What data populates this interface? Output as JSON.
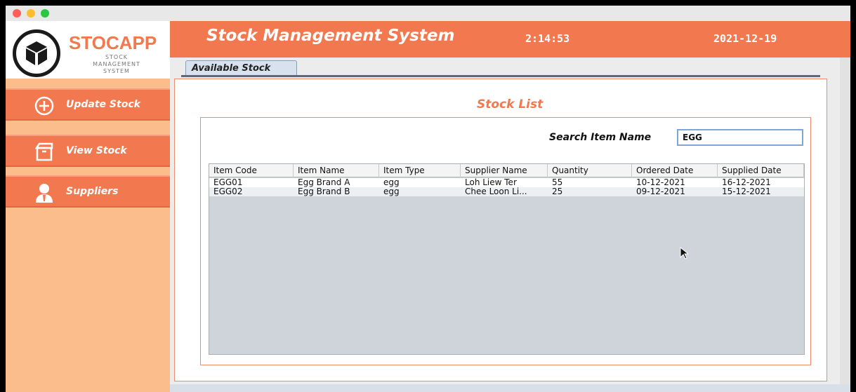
{
  "sidebar": {
    "logo_title": "STOCAPP",
    "logo_sub_1": "STOCK",
    "logo_sub_2": "MANAGEMENT",
    "logo_sub_3": "SYSTEM",
    "items": [
      {
        "label": "Update Stock",
        "icon": "plus-circle-icon"
      },
      {
        "label": "View Stock",
        "icon": "box-icon"
      },
      {
        "label": "Suppliers",
        "icon": "user-icon"
      }
    ]
  },
  "header": {
    "title": "Stock Management System",
    "clock": "2:14:53",
    "date": "2021-12-19"
  },
  "tabs": [
    {
      "label": "Available Stock",
      "active": true
    }
  ],
  "main": {
    "title": "Stock List",
    "search": {
      "label": "Search Item Name",
      "value": "EGG"
    },
    "table": {
      "columns": [
        "Item Code",
        "Item Name",
        "Item Type",
        "Supplier Name",
        "Quantity",
        "Ordered Date",
        "Supplied Date"
      ],
      "rows": [
        [
          "EGG01",
          "Egg Brand A",
          "egg",
          "Loh Liew Ter",
          "55",
          "10-12-2021",
          "16-12-2021"
        ],
        [
          "EGG02",
          "Egg Brand B",
          "egg",
          "Chee Loon Li...",
          "25",
          "09-12-2021",
          "15-12-2021"
        ]
      ]
    }
  },
  "colors": {
    "accent": "#f2784f",
    "sidebar_bg": "#fbbd8c",
    "table_bg": "#cfd4da"
  }
}
